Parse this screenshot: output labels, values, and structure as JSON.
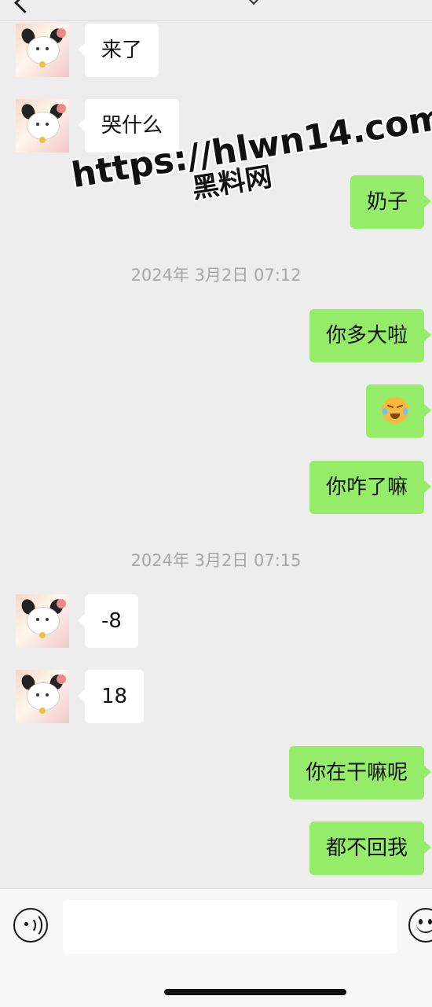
{
  "messages": [
    {
      "side": "in",
      "text": "来了"
    },
    {
      "side": "in",
      "text": "哭什么"
    },
    {
      "side": "out",
      "text": "奶子"
    },
    {
      "type": "timestamp",
      "text": "2024年 3月2日 07:12"
    },
    {
      "side": "out",
      "text": "你多大啦"
    },
    {
      "side": "out",
      "emoji": "crying-laughing-face-icon"
    },
    {
      "side": "out",
      "text": "你咋了嘛"
    },
    {
      "type": "timestamp",
      "text": "2024年 3月2日 07:15"
    },
    {
      "side": "in",
      "text": "-8"
    },
    {
      "side": "in",
      "text": "18"
    },
    {
      "side": "out",
      "text": "你在干嘛呢"
    },
    {
      "side": "out",
      "text": "都不回我"
    }
  ],
  "watermark": {
    "url": "https://hlwn14.com",
    "name": "黑料网"
  },
  "input": {
    "value": ""
  },
  "colors": {
    "background": "#ededed",
    "outgoing_bubble": "#95ec69",
    "incoming_bubble": "#ffffff",
    "timestamp_text": "#a6a6a6"
  }
}
